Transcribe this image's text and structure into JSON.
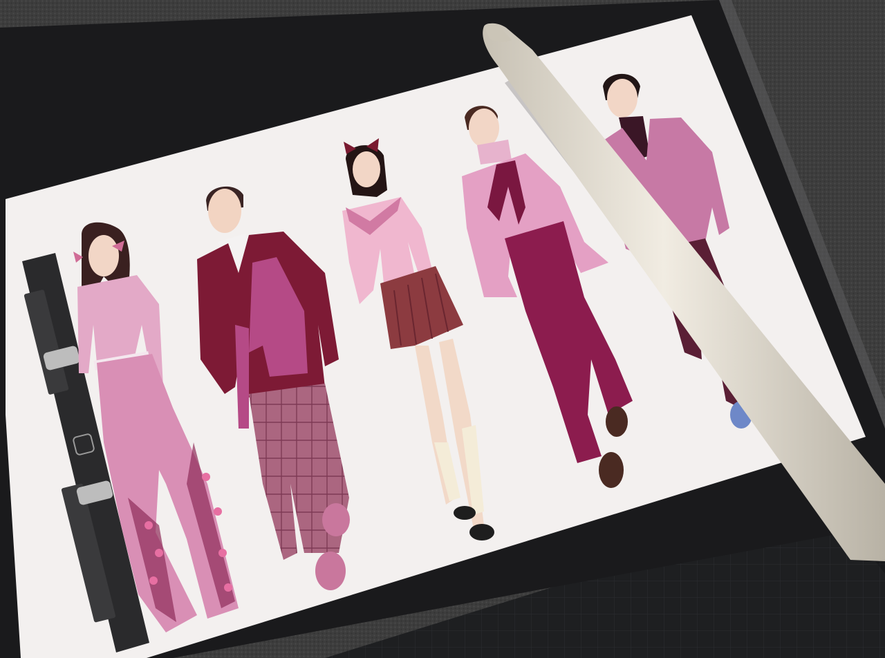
{
  "scene": {
    "subject": "tablet-sketch-photo",
    "tablet": {
      "screen": "fashion-illustration-canvas"
    },
    "sidebar": {
      "controls": [
        {
          "name": "brush-size-slider",
          "kind": "slider"
        },
        {
          "name": "modify-button",
          "kind": "button"
        },
        {
          "name": "opacity-slider",
          "kind": "slider"
        }
      ]
    },
    "illustration": {
      "figures": [
        {
          "name": "figure-1-woman-pink-top-wide-pants"
        },
        {
          "name": "figure-2-man-maroon-blazer-plaid-pants"
        },
        {
          "name": "figure-3-woman-bow-hair-pleated-skirt"
        },
        {
          "name": "figure-4-woman-ruffle-blouse-wide-pants"
        },
        {
          "name": "figure-5-man-pink-suit"
        }
      ]
    },
    "stylus": {
      "name": "apple-pencil"
    },
    "colors": {
      "desk": "#3c3c3c",
      "bezel": "#1b1b1d",
      "canvas": "#f3f0f0",
      "pink_light": "#e3a9c7",
      "pink_mid": "#c97aa6",
      "maroon": "#7d1a35",
      "magenta": "#8c1c4e",
      "plaid": "#a8607a",
      "pencil": "#e9e4d8"
    }
  }
}
